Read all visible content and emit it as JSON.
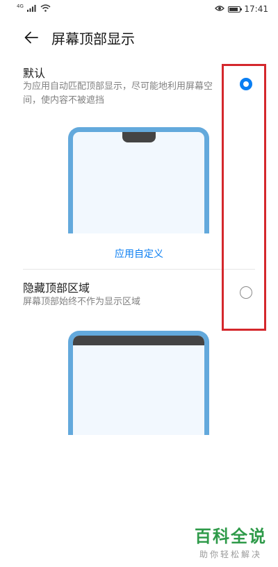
{
  "status_bar": {
    "signal_label": "4G",
    "time": "17:41",
    "battery_level": 0.85,
    "icons": [
      "signal-icon",
      "wifi-icon",
      "eye-icon",
      "battery-icon"
    ]
  },
  "header": {
    "back_icon": "arrow-left-icon",
    "title": "屏幕顶部显示"
  },
  "options": [
    {
      "title": "默认",
      "description": "为应用自动匹配顶部显示，尽可能地利用屏幕空间，使内容不被遮挡",
      "selected": true,
      "illustration": "notch-display",
      "link_label": "应用自定义"
    },
    {
      "title": "隐藏顶部区域",
      "description": "屏幕顶部始终不作为显示区域",
      "selected": false,
      "illustration": "hidden-top-display"
    }
  ],
  "watermark": {
    "main": "百科全说",
    "sub": "助你轻松解决"
  },
  "colors": {
    "accent": "#0a7ef2",
    "phone_frame": "#63a9dc",
    "highlight": "#d4272c",
    "watermark": "#2e9a49"
  }
}
